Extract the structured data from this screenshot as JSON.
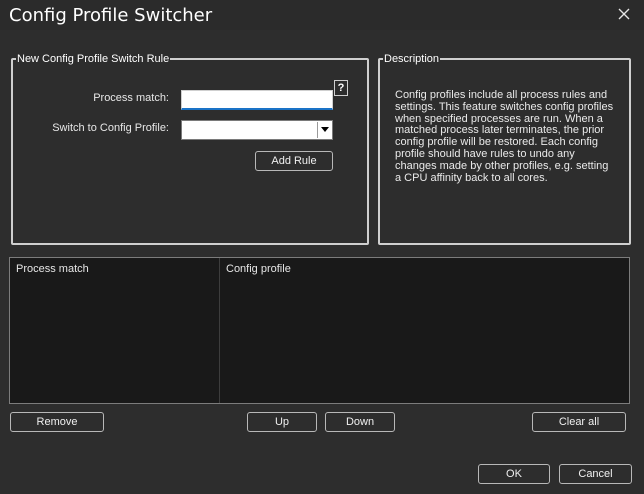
{
  "window": {
    "title": "Config Profile Switcher",
    "close_icon": "close-icon"
  },
  "rule_group": {
    "legend": "New Config Profile Switch Rule",
    "process_label": "Process match:",
    "process_value": "",
    "help_label": "?",
    "switch_label": "Switch to Config Profile:",
    "switch_selected": "",
    "add_rule_label": "Add Rule"
  },
  "description": {
    "legend": "Description",
    "text": "Config profiles include all process rules and settings. This feature switches config profiles when specified processes are run. When a matched process later terminates, the prior config profile will be restored. Each config profile should have rules to undo any changes made by other profiles, e.g. setting a CPU affinity back to all cores."
  },
  "rules_table": {
    "columns": [
      "Process match",
      "Config profile"
    ],
    "rows": []
  },
  "buttons": {
    "remove": "Remove",
    "up": "Up",
    "down": "Down",
    "clear_all": "Clear all",
    "ok": "OK",
    "cancel": "Cancel"
  },
  "colors": {
    "background": "#2d2d2d",
    "input_focus": "#1a73c7",
    "list_background": "#191919"
  }
}
